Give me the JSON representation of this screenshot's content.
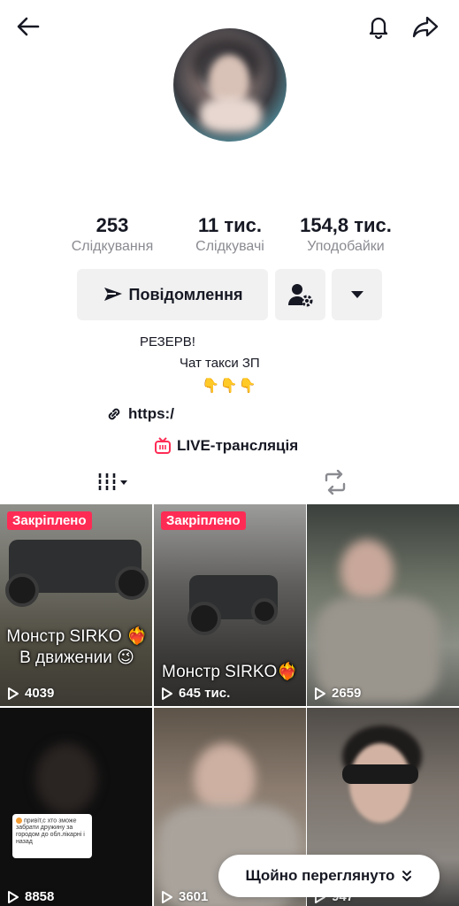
{
  "header": {
    "back_icon": "arrow-left-icon",
    "bell_icon": "bell-icon",
    "share_icon": "share-arrow-icon"
  },
  "stats": {
    "following": {
      "value": "253",
      "label": "Слідкування"
    },
    "followers": {
      "value": "11 тис.",
      "label": "Слідкувачі"
    },
    "likes": {
      "value": "154,8 тис.",
      "label": "Уподобайки"
    }
  },
  "actions": {
    "message_label": "Повідомлення",
    "message_icon": "send-icon",
    "friend_icon": "person-gear-icon",
    "more_icon": "caret-down-icon"
  },
  "bio": {
    "line1": "РЕЗЕРВ!",
    "line2": "Чат такси ЗП",
    "line3": "👇👇👇"
  },
  "link": {
    "text": "https:/",
    "icon": "link-icon"
  },
  "live": {
    "text": "LIVE-трансляція",
    "icon": "live-tv-icon"
  },
  "tabs": {
    "videos_icon": "grid-bars-icon",
    "reposts_icon": "repost-icon"
  },
  "colors": {
    "pinned_bg": "#fe2c55",
    "text": "#161823",
    "muted": "#8a8b91",
    "button_bg": "#f1f1f2"
  },
  "videos": [
    {
      "pinned": "Закріплено",
      "caption": "Монстр SIRKO ❤️‍🔥\nВ движении 😉",
      "views": "4039"
    },
    {
      "pinned": "Закріплено",
      "caption": "Монстр SIRKO❤️‍🔥",
      "views": "645 тис."
    },
    {
      "views": "2659"
    },
    {
      "comment_text": "привіт,с хто зможе забрати дружину за городом до обл.лікарні і назад",
      "views": "8858"
    },
    {
      "views": "3601"
    },
    {
      "views": "947"
    }
  ],
  "recent_button": {
    "label": "Щойно переглянуто",
    "icon": "double-chevron-down-icon"
  }
}
